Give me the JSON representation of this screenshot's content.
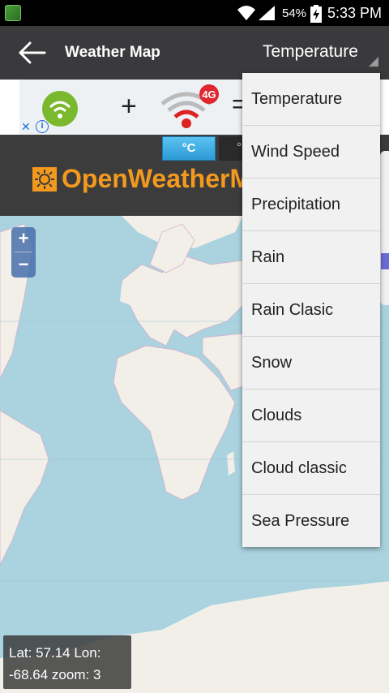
{
  "status_bar": {
    "battery_percent": "54%",
    "time": "5:33 PM"
  },
  "toolbar": {
    "title": "Weather Map",
    "selected_layer": "Temperature"
  },
  "ad": {
    "plus": "+",
    "equals": "=",
    "router_badge": "4G",
    "close_icon": "close-icon",
    "info_icon": "info-icon"
  },
  "owm": {
    "unit_celsius": "°C",
    "unit_fahrenheit": "°",
    "logo_text": "OpenWeatherMap"
  },
  "map": {
    "zoom_in": "+",
    "zoom_out": "−",
    "coords_line1": "Lat: 57.14 Lon:",
    "coords_line2": "-68.64 zoom: 3"
  },
  "layer_menu": {
    "items": [
      "Temperature",
      "Wind Speed",
      "Precipitation",
      "Rain",
      "Rain Clasic",
      "Snow",
      "Clouds",
      "Cloud classic",
      "Sea Pressure"
    ]
  },
  "colors": {
    "toolbar": "#3a3a3d",
    "ocean": "#aad3df",
    "land": "#f2efe9",
    "accent_orange": "#f39a1e",
    "unit_button": "#2c9ad6"
  }
}
